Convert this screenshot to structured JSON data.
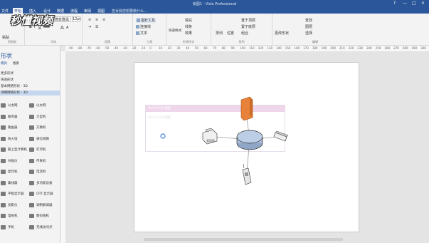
{
  "window": {
    "title": "绘图1 - Visio Professional",
    "controls": [
      "?",
      "—",
      "□",
      "×"
    ]
  },
  "menu": {
    "tabs": [
      "文件",
      "开始",
      "插入",
      "设计",
      "数据",
      "流程",
      "审阅",
      "视图"
    ],
    "search": "告诉我您想要做什么...",
    "active_index": 1
  },
  "ribbon": {
    "clipboard": {
      "label": "剪贴板",
      "cut": "剪切",
      "copy": "复制",
      "format_painter": "格式刷",
      "paste": "粘贴"
    },
    "font": {
      "label": "字体",
      "font_name": "微软雅黑",
      "font_size": "12pt",
      "bold": "B",
      "italic": "I",
      "underline": "U",
      "strike": "abc",
      "grow": "A",
      "shrink": "A"
    },
    "paragraph": {
      "label": "段落"
    },
    "tools": {
      "label": "工具",
      "pointer": "指针工具",
      "connector": "连接线",
      "text": "文本"
    },
    "shape_styles": {
      "label": "形状样式",
      "quick_styles": "快速样式",
      "fill": "填充",
      "line": "线条",
      "effects": "效果"
    },
    "arrange": {
      "label": "排列",
      "align": "排列",
      "position": "位置",
      "bring_front": "置于顶层",
      "send_back": "置于底层",
      "group": "组合"
    },
    "editing": {
      "label": "编辑",
      "find": "查找",
      "layers": "图层",
      "select": "选择",
      "change_shape": "更改形状"
    }
  },
  "watermark": "秒懂视频",
  "shapes_panel": {
    "title": "形状",
    "subtabs": [
      "模具",
      "搜索"
    ],
    "stencils": [
      "更多形状",
      "快速形状",
      "基本网络形状 - 3D",
      "详细网络形状 - 3D"
    ],
    "selected_stencil": 3,
    "items": [
      [
        "以太网",
        "以太网"
      ],
      [
        "服务器",
        "大型机"
      ],
      [
        "路由器",
        "交换机"
      ],
      [
        "防火墙",
        "通信链路"
      ],
      [
        "膝上型计算机",
        "打印机"
      ],
      [
        "扫描仪",
        "传真机"
      ],
      [
        "复印机",
        "电话机"
      ],
      [
        "集线器",
        "多功能设备"
      ],
      [
        "平板显示器",
        "CRT 显示器"
      ],
      [
        "投影仪",
        "调制解调器"
      ],
      [
        "电视机",
        "数码相机"
      ],
      [
        "手机",
        "无线访问点"
      ]
    ]
  },
  "ruler": {
    "marks": [
      "-90",
      "-80",
      "-70",
      "-60",
      "-50",
      "-40",
      "-30",
      "-20",
      "-10",
      "0",
      "10",
      "20",
      "30",
      "40",
      "50",
      "60",
      "70",
      "80",
      "90",
      "100",
      "110",
      "120",
      "130",
      "140",
      "150",
      "160",
      "170",
      "180",
      "190",
      "200",
      "210",
      "220",
      "230",
      "240",
      "250",
      "260",
      "270",
      "280",
      "290",
      "300"
    ]
  },
  "diagram": {
    "container_title": "Visio CAD 图纸",
    "container_subtitle": "Visio CAD 图纸"
  },
  "colors": {
    "brand": "#2b579a",
    "ribbon": "#f3f3f3",
    "hub": "#9fb5d4",
    "firewall": "#e8823a"
  }
}
